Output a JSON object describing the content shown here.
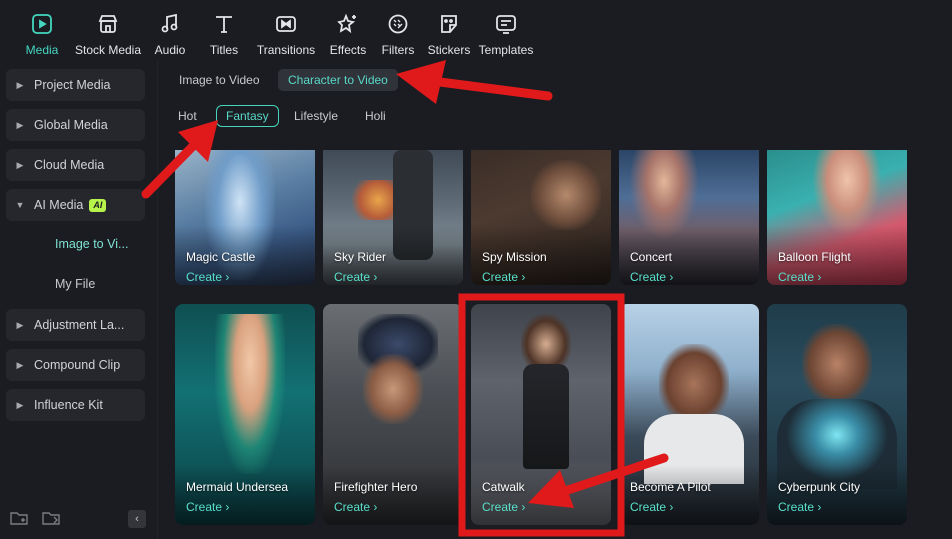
{
  "toolbar": {
    "items": [
      {
        "label": "Media",
        "icon": "media-icon",
        "active": true
      },
      {
        "label": "Stock Media",
        "icon": "stock-media-icon"
      },
      {
        "label": "Audio",
        "icon": "music-note-icon"
      },
      {
        "label": "Titles",
        "icon": "text-t-icon"
      },
      {
        "label": "Transitions",
        "icon": "transitions-icon"
      },
      {
        "label": "Effects",
        "icon": "effects-star-icon"
      },
      {
        "label": "Filters",
        "icon": "filters-icon"
      },
      {
        "label": "Stickers",
        "icon": "sticker-icon"
      },
      {
        "label": "Templates",
        "icon": "templates-icon"
      }
    ],
    "accent": "#44d6c0"
  },
  "sidebar": {
    "items": [
      {
        "label": "Project Media"
      },
      {
        "label": "Global Media"
      },
      {
        "label": "Cloud Media"
      },
      {
        "label": "AI Media",
        "badge": "AI",
        "expanded": true
      },
      {
        "label": "Adjustment La..."
      },
      {
        "label": "Compound Clip"
      },
      {
        "label": "Influence Kit"
      }
    ],
    "subitems": [
      {
        "label": "Image to Vi...",
        "active": true
      },
      {
        "label": "My File"
      }
    ]
  },
  "main": {
    "tabs": [
      {
        "label": "Image to Video"
      },
      {
        "label": "Character to Video",
        "active": true
      }
    ],
    "filters": [
      {
        "label": "Hot"
      },
      {
        "label": "Fantasy",
        "active": true
      },
      {
        "label": "Lifestyle"
      },
      {
        "label": "Holi"
      }
    ],
    "create_label": "Create",
    "cards": [
      {
        "title": "Magic Castle"
      },
      {
        "title": "Sky Rider"
      },
      {
        "title": "Spy Mission"
      },
      {
        "title": "Concert"
      },
      {
        "title": "Balloon Flight"
      },
      {
        "title": "Mermaid Undersea"
      },
      {
        "title": "Firefighter Hero"
      },
      {
        "title": "Catwalk",
        "highlighted": true
      },
      {
        "title": "Become A Pilot"
      },
      {
        "title": "Cyberpunk City"
      }
    ]
  },
  "annotation_color": "#e0191b"
}
